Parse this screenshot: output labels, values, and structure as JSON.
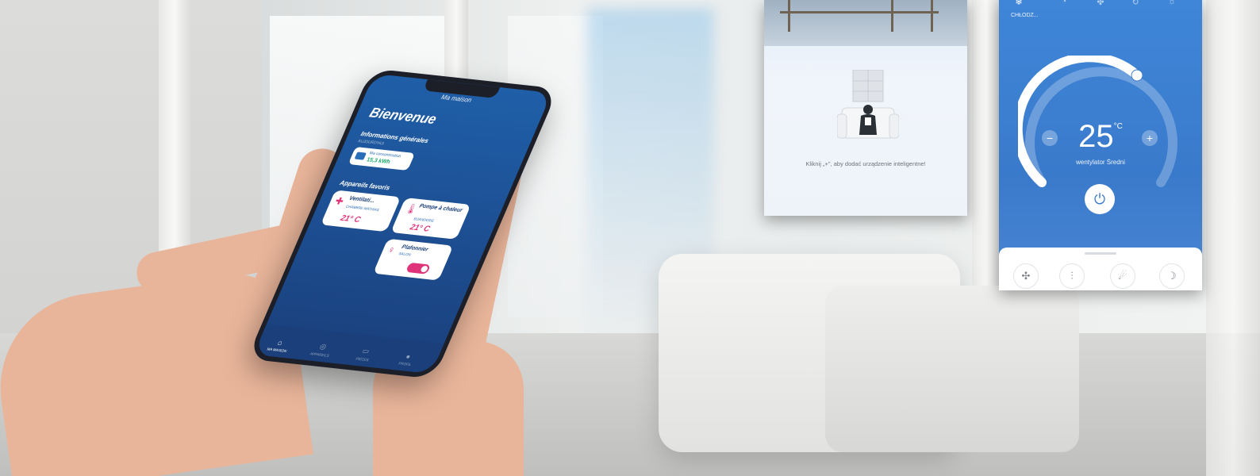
{
  "phone": {
    "title": "Ma maison",
    "welcome": "Bienvenue",
    "info_heading": "Informations générales",
    "info_sub": "AUJOURD'HUI",
    "energy": {
      "label": "Ma consommation",
      "value": "15,3 kWh",
      "icon": "meter-icon"
    },
    "favorites_heading": "Appareils favoris",
    "cards": [
      {
        "name": "Ventilati...",
        "room": "CHAMBRE MATHIAS",
        "value": "21° C",
        "icon": "fan-icon"
      },
      {
        "name": "Pompe à chaleur",
        "room": "BUANDERIE",
        "value": "21° C",
        "icon": "thermometer-icon"
      },
      {
        "name": "Plafonnier",
        "room": "SALON",
        "value": "",
        "icon": "lightbulb-icon",
        "toggle_on": true
      }
    ],
    "tabs": [
      {
        "label": "MA MAISON",
        "icon": "home-icon",
        "active": true
      },
      {
        "label": "APPAREILS",
        "icon": "devices-icon",
        "active": false
      },
      {
        "label": "PIÈCES",
        "icon": "rooms-icon",
        "active": false
      },
      {
        "label": "PROFIL",
        "icon": "profile-icon",
        "active": false
      }
    ]
  },
  "screen1": {
    "message": "Kliknij „+\", aby dodać urządzenie inteligentne!"
  },
  "screen2": {
    "mode_label": "CHŁODZ...",
    "modes": [
      "snowflake-icon",
      "dry-icon",
      "fan-icon",
      "auto-icon",
      "sun-icon"
    ],
    "temperature": "25",
    "unit": "°C",
    "fan_label": "wentylator Średni",
    "minus": "−",
    "plus": "+",
    "bottom_buttons": [
      "fan-speed-icon",
      "sliders-icon",
      "turbo-icon",
      "sleep-icon"
    ]
  },
  "colors": {
    "phone_blue": "#1d4f93",
    "accent_pink": "#e0347a",
    "ac_blue": "#3a7acb"
  }
}
